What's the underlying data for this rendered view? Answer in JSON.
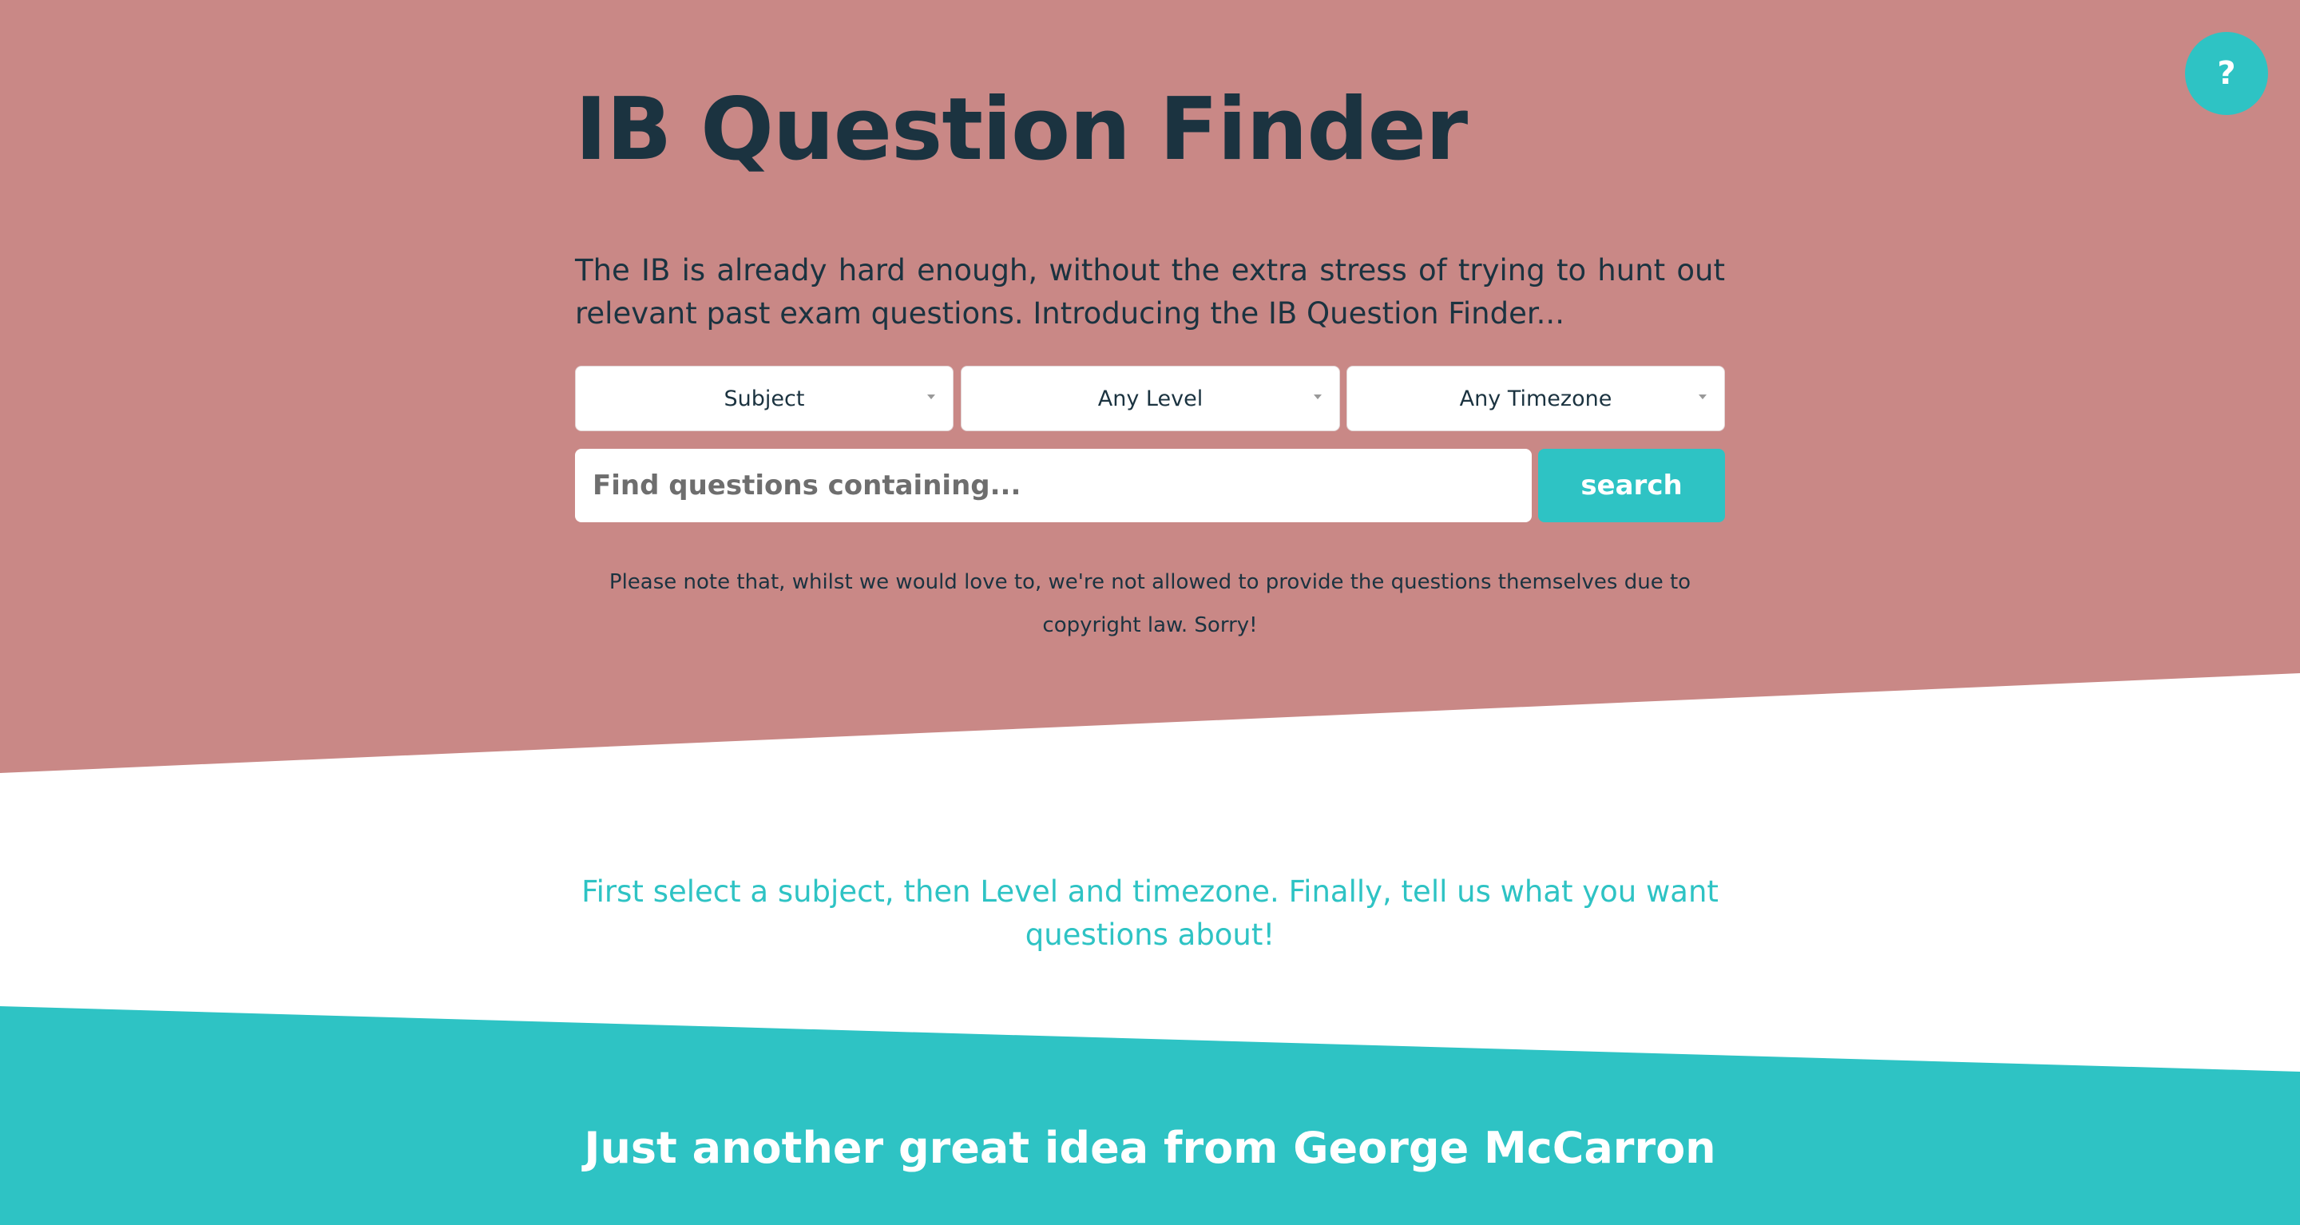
{
  "colors": {
    "hero_background": "#c98886",
    "accent": "#2ec3c4",
    "title_text": "#1b3340",
    "body_text": "#1b3340",
    "footer_background": "#2ec3c4"
  },
  "help": {
    "label": "?"
  },
  "hero": {
    "title": "IB Question Finder",
    "intro": "The IB is already hard enough, without the extra stress of trying to hunt out relevant past exam questions. Introducing the IB Question Finder...",
    "selects": [
      {
        "label": "Subject",
        "icon": "chevron-down-icon"
      },
      {
        "label": "Any Level",
        "icon": "chevron-down-icon"
      },
      {
        "label": "Any Timezone",
        "icon": "chevron-down-icon"
      }
    ],
    "search": {
      "placeholder": "Find questions containing...",
      "value": "",
      "button_label": "search"
    },
    "disclaimer": "Please note that, whilst we would love to, we're not allowed to provide the questions themselves due to copyright law. Sorry!"
  },
  "instruction": "First select a subject, then Level and timezone. Finally, tell us what you want questions about!",
  "footer": {
    "text": "Just another great idea from George McCarron"
  }
}
